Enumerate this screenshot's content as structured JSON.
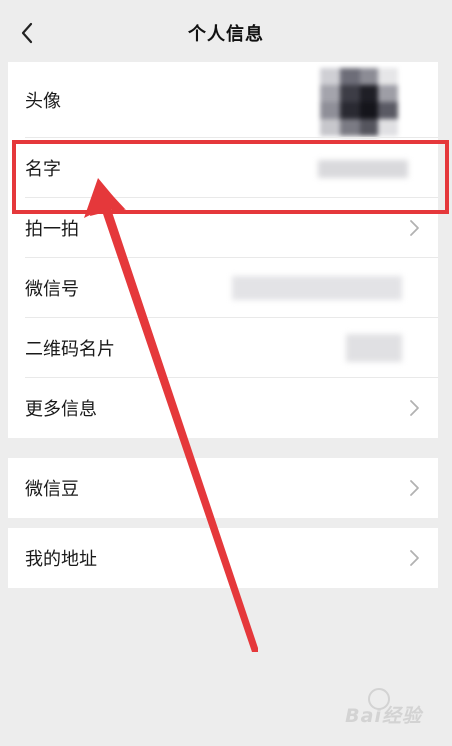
{
  "nav": {
    "title": "个人信息",
    "back_icon": "chevron-left-icon"
  },
  "groups": [
    {
      "rows": [
        {
          "label": "头像",
          "value": "",
          "has_chevron": false
        },
        {
          "label": "名字",
          "value": "",
          "has_chevron": false
        },
        {
          "label": "拍一拍",
          "value": "",
          "has_chevron": true
        },
        {
          "label": "微信号",
          "value": "",
          "has_chevron": false
        },
        {
          "label": "二维码名片",
          "value": "",
          "has_chevron": false
        },
        {
          "label": "更多信息",
          "value": "",
          "has_chevron": true
        }
      ]
    },
    {
      "rows": [
        {
          "label": "微信豆",
          "value": "",
          "has_chevron": true
        }
      ]
    },
    {
      "rows": [
        {
          "label": "我的地址",
          "value": "",
          "has_chevron": true
        }
      ]
    }
  ],
  "annotation": {
    "highlight_color": "#e5383b",
    "arrow_color": "#e5383b"
  },
  "watermark": {
    "text": "Bai经验"
  },
  "colors": {
    "background": "#ededed",
    "card": "#ffffff",
    "text": "#1a1a1a",
    "chevron": "#b2b2b2"
  }
}
